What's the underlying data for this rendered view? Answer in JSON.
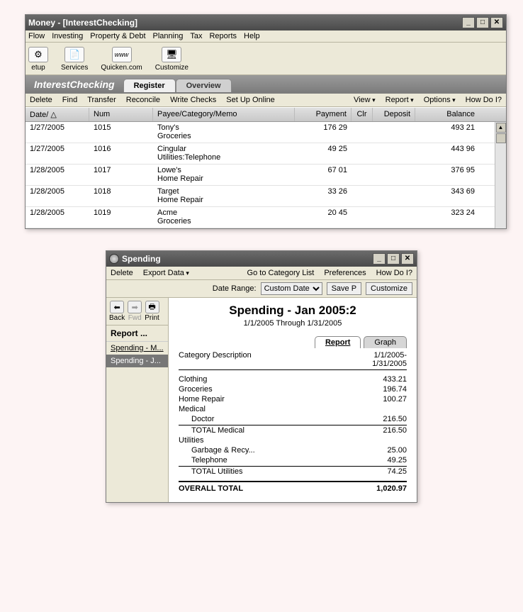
{
  "main": {
    "title": "Money - [InterestChecking]",
    "menubar": [
      "Flow",
      "Investing",
      "Property & Debt",
      "Planning",
      "Tax",
      "Reports",
      "Help"
    ],
    "toolbar": [
      {
        "label": "etup",
        "glyph": "⚙"
      },
      {
        "label": "Services",
        "glyph": "📄"
      },
      {
        "label": "Quicken.com",
        "glyph": "www"
      },
      {
        "label": "Customize",
        "glyph": "🖥"
      }
    ],
    "account": "InterestChecking",
    "tabs": {
      "register": "Register",
      "overview": "Overview"
    },
    "subbar_left": [
      "Delete",
      "Find",
      "Transfer",
      "Reconcile",
      "Write Checks",
      "Set Up Online"
    ],
    "subbar_right": [
      "View",
      "Report",
      "Options",
      "How Do I?"
    ],
    "columns": {
      "date": "Date/ △",
      "num": "Num",
      "payee": "Payee/Category/Memo",
      "payment": "Payment",
      "clr": "Clr",
      "deposit": "Deposit",
      "balance": "Balance"
    },
    "rows": [
      {
        "date": "1/27/2005",
        "num": "1015",
        "payee": "Tony's",
        "cat": "Groceries",
        "payment": "176 29",
        "balance": "493 21"
      },
      {
        "date": "1/27/2005",
        "num": "1016",
        "payee": "Cingular",
        "cat": "Utilities:Telephone",
        "payment": "49 25",
        "balance": "443 96"
      },
      {
        "date": "1/28/2005",
        "num": "1017",
        "payee": "Lowe's",
        "cat": "Home Repair",
        "payment": "67 01",
        "balance": "376 95"
      },
      {
        "date": "1/28/2005",
        "num": "1018",
        "payee": "Target",
        "cat": "Home Repair",
        "payment": "33 26",
        "balance": "343 69"
      },
      {
        "date": "1/28/2005",
        "num": "1019",
        "payee": "Acme",
        "cat": "Groceries",
        "payment": "20 45",
        "balance": "323 24"
      }
    ]
  },
  "spending": {
    "title": "Spending",
    "menus": {
      "delete": "Delete",
      "export": "Export Data",
      "gotocat": "Go to Category List",
      "prefs": "Preferences",
      "howdo": "How Do I?"
    },
    "range_label": "Date Range:",
    "range_value": "Custom Date",
    "save": "Save P",
    "customize": "Customize",
    "nav": {
      "back": "Back",
      "fwd": "Fwd",
      "print": "Print"
    },
    "side_header": "Report ...",
    "side_items": [
      "Spending - M...",
      "Spending - J..."
    ],
    "report_title": "Spending - Jan 2005:2",
    "report_range": "1/1/2005 Through 1/31/2005",
    "tabs": {
      "report": "Report",
      "graph": "Graph"
    },
    "col_left": "Category Description",
    "col_right_1": "1/1/2005-",
    "col_right_2": "1/31/2005",
    "lines": [
      {
        "label": "Clothing",
        "amt": "433.21"
      },
      {
        "label": "Groceries",
        "amt": "196.74"
      },
      {
        "label": "Home Repair",
        "amt": "100.27"
      },
      {
        "label": "Medical",
        "amt": ""
      },
      {
        "label": "Doctor",
        "amt": "216.50",
        "indent": true,
        "rule": true
      },
      {
        "label": "TOTAL Medical",
        "amt": "216.50",
        "indent": true
      },
      {
        "label": "Utilities",
        "amt": ""
      },
      {
        "label": "Garbage & Recy...",
        "amt": "25.00",
        "indent": true
      },
      {
        "label": "Telephone",
        "amt": "49.25",
        "indent": true,
        "rule": true
      },
      {
        "label": "TOTAL Utilities",
        "amt": "74.25",
        "indent": true
      }
    ],
    "overall_label": "OVERALL TOTAL",
    "overall_amt": "1,020.97"
  }
}
